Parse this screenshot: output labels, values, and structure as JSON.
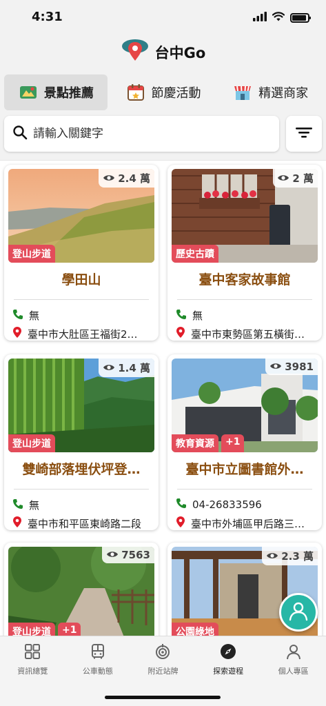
{
  "status_bar": {
    "time": "4:31"
  },
  "header": {
    "title": "台中Go"
  },
  "tabs": [
    {
      "label": "景點推薦",
      "icon": "attraction-icon",
      "active": true
    },
    {
      "label": "節慶活動",
      "icon": "calendar-icon",
      "active": false
    },
    {
      "label": "精選商家",
      "icon": "store-icon",
      "active": false
    }
  ],
  "search": {
    "placeholder": "請輸入關鍵字",
    "value": ""
  },
  "cards": [
    {
      "name": "學田山",
      "views": "2.4 萬",
      "tags": [
        "登山步道"
      ],
      "phone": "無",
      "address": "臺中市大肚區王福街2…"
    },
    {
      "name": "臺中客家故事館",
      "views": "2 萬",
      "tags": [
        "歷史古蹟"
      ],
      "phone": "無",
      "address": "臺中市東勢區第五橫街…"
    },
    {
      "name": "雙崎部落埋伏坪登…",
      "views": "1.4 萬",
      "tags": [
        "登山步道"
      ],
      "phone": "無",
      "address": "臺中市和平區東崎路二段"
    },
    {
      "name": "臺中市立圖書館外…",
      "views": "3981",
      "tags": [
        "教育資源",
        "+1"
      ],
      "phone": "04-26833596",
      "address": "臺中市外埔區甲后路三…"
    },
    {
      "name": "",
      "views": "7563",
      "tags": [
        "登山步道",
        "+1"
      ],
      "phone": "",
      "address": ""
    },
    {
      "name": "",
      "views": "2.3 萬",
      "tags": [
        "公園綠地"
      ],
      "phone": "",
      "address": ""
    }
  ],
  "bottom_nav": [
    {
      "label": "資訊總覽",
      "icon": "grid-icon",
      "active": false
    },
    {
      "label": "公車動態",
      "icon": "bus-icon",
      "active": false
    },
    {
      "label": "附近站牌",
      "icon": "nearby-stop-icon",
      "active": false
    },
    {
      "label": "探索遊程",
      "icon": "compass-icon",
      "active": true
    },
    {
      "label": "個人專區",
      "icon": "user-icon",
      "active": false
    }
  ],
  "colors": {
    "tag": "#e34c5a",
    "title": "#8a4e10",
    "fab": "#27b7a6",
    "pin": "#e11d2a",
    "phone": "#1f8a2a"
  }
}
